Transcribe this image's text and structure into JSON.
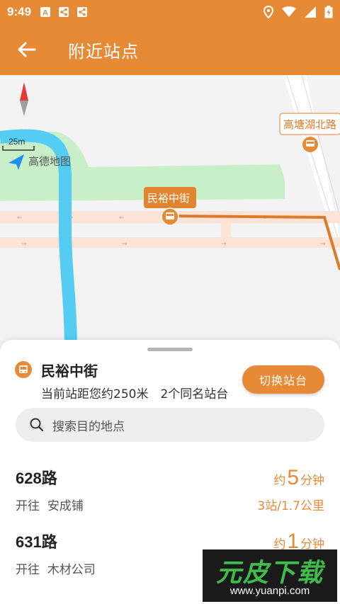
{
  "status_bar": {
    "time": "9:49"
  },
  "app_bar": {
    "title": "附近站点"
  },
  "map": {
    "scale": "25m",
    "logo_text": "高德地图",
    "marker_main": "民裕中街",
    "marker_secondary": "高塘湖北路"
  },
  "station": {
    "name": "民裕中街",
    "info": "当前站距您约250米　2个同名站台",
    "switch_label": "切换站台"
  },
  "search": {
    "placeholder": "搜索目的地点"
  },
  "routes": [
    {
      "name": "628路",
      "dest_prefix": "开往",
      "dest": "安成铺",
      "eta_prefix": "约",
      "eta_num": "5",
      "eta_unit": "分钟",
      "distance": "3站/1.7公里"
    },
    {
      "name": "631路",
      "dest_prefix": "开往",
      "dest": "木材公司",
      "eta_prefix": "约",
      "eta_num": "1",
      "eta_unit": "分钟",
      "distance": ""
    }
  ],
  "watermark": {
    "logo": "元皮下载",
    "url": "www.yuanpi.com"
  },
  "colors": {
    "accent": "#e78a35",
    "park": "#c9efc9",
    "river": "#55cdf2",
    "road": "#fce3d6"
  }
}
